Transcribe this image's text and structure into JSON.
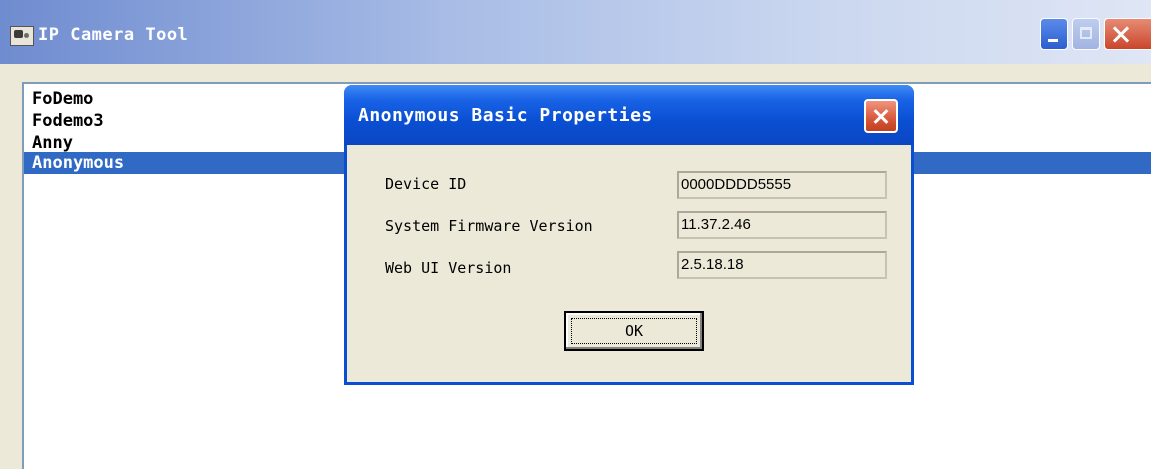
{
  "window": {
    "title": "IP Camera Tool"
  },
  "device_list": {
    "items": [
      "FoDemo",
      "Fodemo3",
      "Anny",
      "Anonymous"
    ],
    "selected_index": 3
  },
  "dialog": {
    "title": "Anonymous Basic Properties",
    "properties": [
      {
        "label": "Device ID",
        "value": "0000DDDD5555"
      },
      {
        "label": "System Firmware Version",
        "value": "11.37.2.46"
      },
      {
        "label": "Web UI Version",
        "value": "2.5.18.18"
      }
    ],
    "ok_label": "OK"
  },
  "colors": {
    "titlebar_accent": "#6f8cd0",
    "dialog_titlebar": "#0a4fd3",
    "selection": "#316ac5",
    "window_bg": "#ece9d8"
  }
}
